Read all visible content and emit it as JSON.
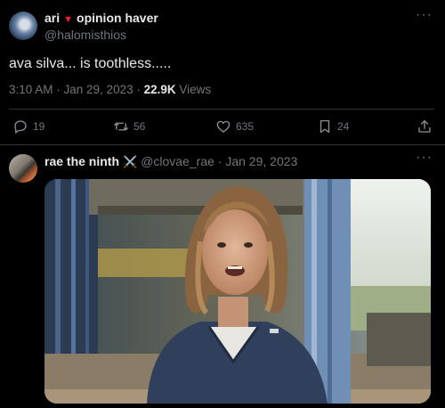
{
  "tweet": {
    "author_name": "ari",
    "author_suffix": "opinion haver",
    "heart_glyph": "🔻",
    "handle": "@halomisthios",
    "text": "ava silva... is toothless.....",
    "timestamp": "3:10 AM · Jan 29, 2023 · ",
    "views_count": "22.9K",
    "views_label": " Views",
    "more_glyph": "···",
    "actions": {
      "replies": "19",
      "retweets": "56",
      "likes": "635",
      "bookmarks": "24"
    }
  },
  "reply": {
    "author_name": "rae the ninth",
    "emoji": "⚔️",
    "handle_date": "@clovae_rae · Jan 29, 2023",
    "more_glyph": "···",
    "media_icon": "photo-of-smiling-young-woman"
  },
  "colors": {
    "background": "#000000",
    "text_primary": "#e7e9ea",
    "text_secondary": "#71767b",
    "divider": "#2f3336",
    "accent_red": "#f4212e"
  }
}
